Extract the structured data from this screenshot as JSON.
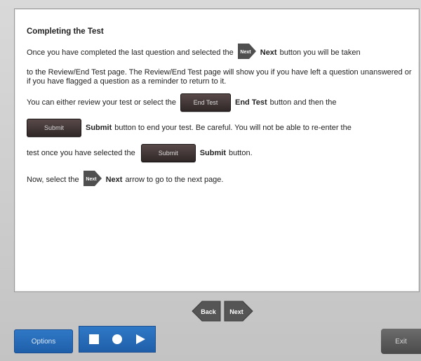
{
  "content": {
    "title": "Completing the Test",
    "p1_a": "Once you have completed the last question and selected the",
    "p1_next_label": "Next",
    "p1_b": "button you will be taken",
    "p1_c": "to the Review/End Test page. The Review/End Test page will show you if you have left a question unanswered or if you have flagged a question as a reminder to return to it.",
    "p2_a": "You can either review your test or select the",
    "p2_endtest_btn": "End Test",
    "p2_endtest_label": "End Test",
    "p2_b": "button and then the",
    "p3_submit_btn": "Submit",
    "p3_submit_label": "Submit",
    "p3_b": "button to end your test. Be careful. You will not be able to re-enter the",
    "p4_a": "test once you have selected the",
    "p4_submit_btn": "Submit",
    "p4_submit_label": "Submit",
    "p4_b": "button.",
    "p5_a": "Now, select the",
    "p5_next_label": "Next",
    "p5_b": "arrow to go to the next page.",
    "next_icon_text": "Next"
  },
  "navigation": {
    "back_label": "Back",
    "next_label": "Next"
  },
  "toolbar": {
    "options_label": "Options",
    "exit_label": "Exit",
    "media_icons": [
      "stop-icon",
      "record-icon",
      "play-icon"
    ]
  },
  "colors": {
    "arrow_fill": "#4f4f4f",
    "options_blue": "#2f79c7",
    "dark_button": "#3d3232"
  }
}
